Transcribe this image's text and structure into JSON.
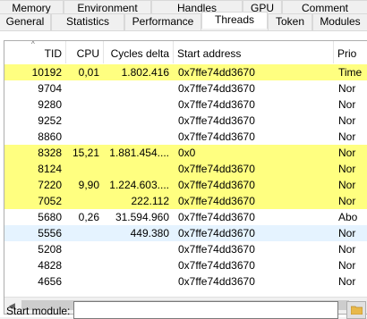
{
  "tabs_row1": [
    "Memory",
    "Environment",
    "Handles",
    "GPU",
    "Comment"
  ],
  "tabs_row2": [
    "General",
    "Statistics",
    "Performance",
    "Threads",
    "Token",
    "Modules"
  ],
  "active_tab": "Threads",
  "table": {
    "sort_indicator": "^",
    "columns": {
      "tid": "TID",
      "cpu": "CPU",
      "cycles": "Cycles delta",
      "address": "Start address",
      "priority": "Prio"
    },
    "rows": [
      {
        "tid": "10192",
        "cpu": "0,01",
        "cycles": "1.802.416",
        "address": "0x7ffe74dd3670",
        "priority": "Time",
        "highlight": "yellow"
      },
      {
        "tid": "9704",
        "cpu": "",
        "cycles": "",
        "address": "0x7ffe74dd3670",
        "priority": "Nor",
        "highlight": "none"
      },
      {
        "tid": "9280",
        "cpu": "",
        "cycles": "",
        "address": "0x7ffe74dd3670",
        "priority": "Nor",
        "highlight": "none"
      },
      {
        "tid": "9252",
        "cpu": "",
        "cycles": "",
        "address": "0x7ffe74dd3670",
        "priority": "Nor",
        "highlight": "none"
      },
      {
        "tid": "8860",
        "cpu": "",
        "cycles": "",
        "address": "0x7ffe74dd3670",
        "priority": "Nor",
        "highlight": "none"
      },
      {
        "tid": "8328",
        "cpu": "15,21",
        "cycles": "1.881.454....",
        "address": "0x0",
        "priority": "Nor",
        "highlight": "yellow"
      },
      {
        "tid": "8124",
        "cpu": "",
        "cycles": "",
        "address": "0x7ffe74dd3670",
        "priority": "Nor",
        "highlight": "yellow"
      },
      {
        "tid": "7220",
        "cpu": "9,90",
        "cycles": "1.224.603....",
        "address": "0x7ffe74dd3670",
        "priority": "Nor",
        "highlight": "yellow"
      },
      {
        "tid": "7052",
        "cpu": "",
        "cycles": "222.112",
        "address": "0x7ffe74dd3670",
        "priority": "Nor",
        "highlight": "yellow"
      },
      {
        "tid": "5680",
        "cpu": "0,26",
        "cycles": "31.594.960",
        "address": "0x7ffe74dd3670",
        "priority": "Abo",
        "highlight": "none"
      },
      {
        "tid": "5556",
        "cpu": "",
        "cycles": "449.380",
        "address": "0x7ffe74dd3670",
        "priority": "Nor",
        "highlight": "selected"
      },
      {
        "tid": "5208",
        "cpu": "",
        "cycles": "",
        "address": "0x7ffe74dd3670",
        "priority": "Nor",
        "highlight": "none"
      },
      {
        "tid": "4828",
        "cpu": "",
        "cycles": "",
        "address": "0x7ffe74dd3670",
        "priority": "Nor",
        "highlight": "none"
      },
      {
        "tid": "4656",
        "cpu": "",
        "cycles": "",
        "address": "0x7ffe74dd3670",
        "priority": "Nor",
        "highlight": "none"
      }
    ]
  },
  "scrollbar": {
    "left_arrow": "◀",
    "right_arrow": "▶"
  },
  "start_module": {
    "label": "Start module:",
    "value": ""
  },
  "colors": {
    "highlight_yellow": "#ffff80",
    "selected_row": "#e5f3ff",
    "folder": "#e8b84a"
  },
  "icons": {
    "folder_button": "folder-icon"
  }
}
